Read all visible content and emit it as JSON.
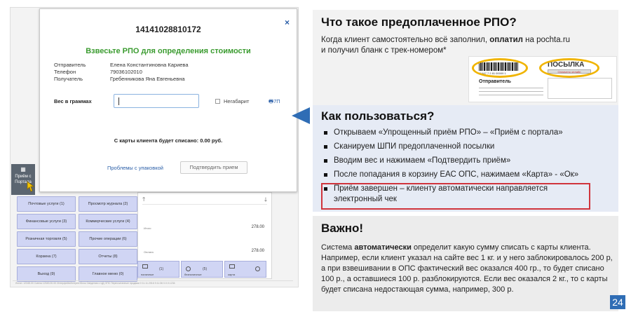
{
  "pos": {
    "side_tile": "Приём с Портала",
    "buttons": [
      "Почтовые услуги (1)",
      "Просмотр журнала (2)",
      "Финансовые услуги (3)",
      "Коммерческие услуги (4)",
      "Розничная торговля (5)",
      "Прочие операции (6)",
      "Корзина (7)",
      "Отчеты (8)",
      "Выход (9)",
      "Главное меню (0)"
    ],
    "panel": {
      "up": "🡑",
      "down": "🡓",
      "label1": "Итого",
      "value1": "278.00",
      "label2": "Оплата",
      "value2": "278.00"
    },
    "pay": [
      {
        "label": "наличные",
        "count": "(1)"
      },
      {
        "label": "безналичные",
        "count": "(5)"
      },
      {
        "label": "карта",
        "count": ""
      }
    ],
    "status": "Логин: 12345.00   Смена 12345.00.00   ИнтерфейсИнтернетБлок   Сведения о ЦД ОПС   Пересчитанные продажи 0   11.11.2016 9:11:36   0.0.0.1234"
  },
  "modal": {
    "close": "×",
    "title": "14141028810172",
    "weigh": "Взвесьте РПО для определения стоимости",
    "info": [
      {
        "k": "Отправитель",
        "v": "Елена Константиновна Кариева"
      },
      {
        "k": "Телефон",
        "v": "79036102010"
      },
      {
        "k": "Получатель",
        "v": "Гребенникова Яна Евгеньевна"
      }
    ],
    "weight_label": "Вес в граммах",
    "nonstandard": "Негабарит",
    "print": "7П",
    "card_msg": "С карты клиента будет списано: 0.00 руб.",
    "problems": "Проблемы с упаковкой",
    "confirm": "Подтвердить прием"
  },
  "slide": {
    "sec1": {
      "title": "Что такое предоплаченное РПО?",
      "p1_a": "Когда клиент самостоятельно всё заполнил, ",
      "p1_b": "оплатил",
      "p1_c": " на pochta.ru",
      "p2": "и получил бланк с трек-номером*",
      "blank_barcode": "11447 7 2 81 00009 1",
      "blank_posylka": "ПОСЫЛКА",
      "blank_oplach": "Оплачено онлайн",
      "blank_otpr": "Отправитель"
    },
    "sec2": {
      "title": "Как пользоваться?",
      "items": [
        "Открываем «Упрощенный приём РПО» – «Приём с портала»",
        "Сканируем ШПИ предоплаченной посылки",
        "Вводим вес и нажимаем «Подтвердить приём»",
        "После попадания в корзину ЕАС ОПС, нажимаем «Карта» - «Ок»",
        "Приём завершен – клиенту автоматически направляется электронный чек"
      ]
    },
    "sec3": {
      "title": "Важно!",
      "a": "Система ",
      "b": "автоматически",
      "c": " определит какую сумму списать с карты клиента. Например, если клиент указал на сайте вес 1 кг. и у него заблокировалось 200 р, а при взвешивании в ОПС фактический вес оказался 400 гр., то будет списано 100 р., а оставшиеся 100 р. разблокируются. Если вес оказался 2 кг., то с карты будет списана недостающая сумма, например, 300 р."
    },
    "page": "24"
  },
  "colors": {
    "accent_blue": "#2f6db5",
    "green": "#3a9b2f",
    "red_box": "#d0343c",
    "oval": "#f0b400",
    "pos_button": "#d0d5f4"
  }
}
